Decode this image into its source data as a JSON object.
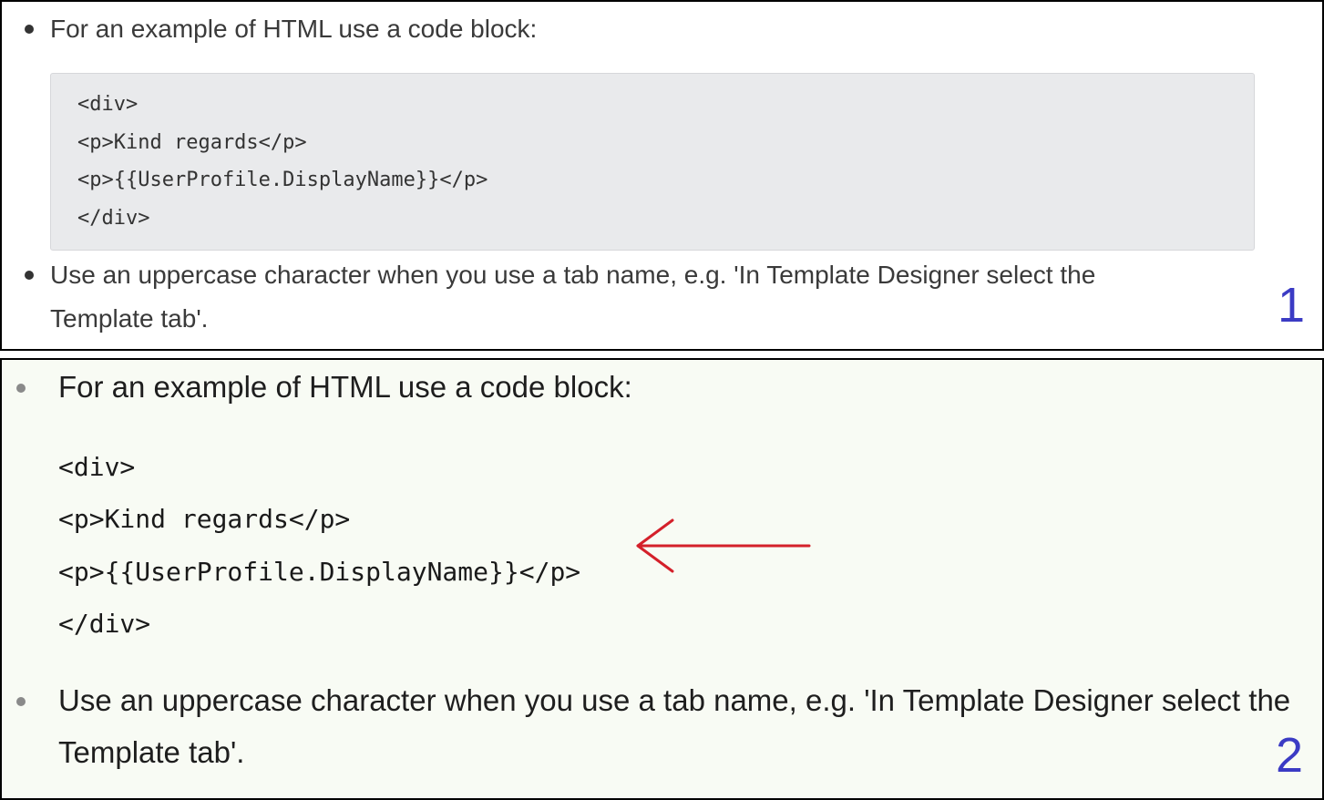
{
  "panels": [
    {
      "number": "1",
      "items": [
        "For an example of HTML use a code block:",
        "Use an uppercase character when you use a tab name, e.g. 'In Template Designer select the",
        "Template tab'."
      ],
      "code_lines": [
        "<div>",
        "<p>Kind regards</p>",
        "<p>{{UserProfile.DisplayName}}</p>",
        "</div>"
      ]
    },
    {
      "number": "2",
      "items": [
        "For an example of HTML use a code block:",
        "Use an uppercase character when you use a tab name, e.g. 'In Template Designer select the",
        "Template tab'."
      ],
      "code_lines": [
        "<div>",
        "<p>Kind regards</p>",
        "<p>{{UserProfile.DisplayName}}</p>",
        "</div>"
      ]
    }
  ],
  "colors": {
    "panel2_background": "#f8fbf4",
    "code_background": "#e9eaec",
    "arrow": "#d4202a",
    "number_label": "#3b3bc4"
  }
}
